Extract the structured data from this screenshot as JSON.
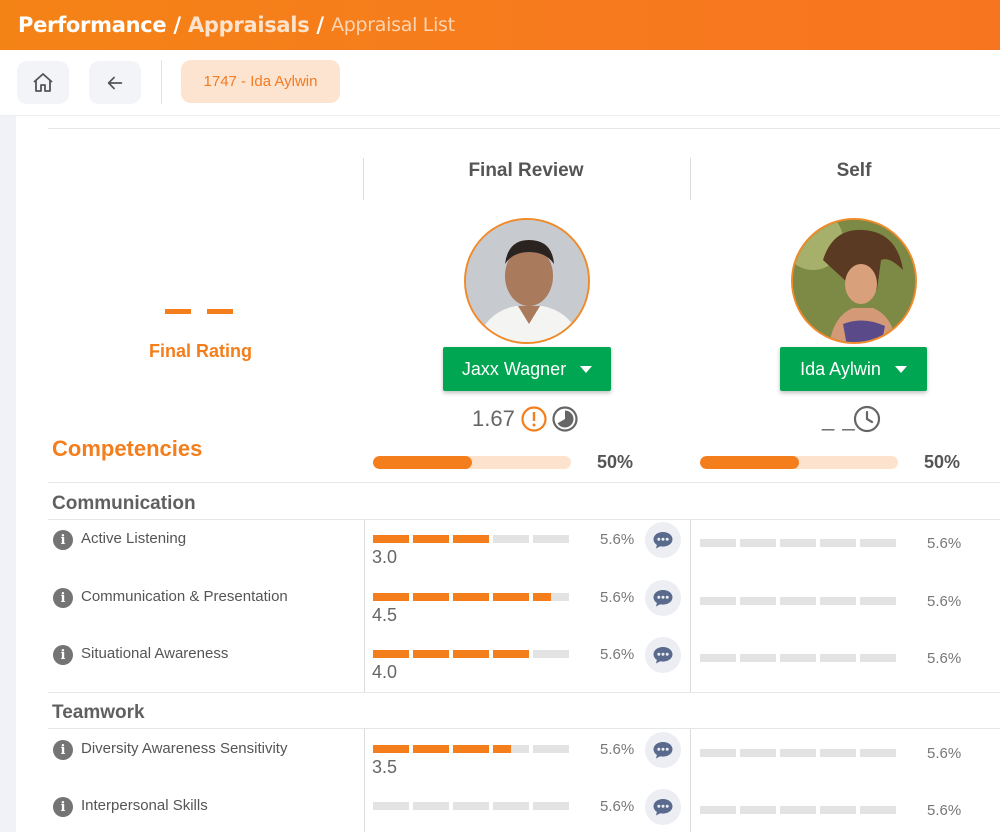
{
  "breadcrumb": {
    "root": "Performance",
    "section": "Appraisals",
    "current": "Appraisal List",
    "separator": "/"
  },
  "toolbar": {
    "home_icon": "home-icon",
    "back_icon": "arrow-left-icon",
    "employee_chip": "1747 - Ida Aylwin"
  },
  "columns": {
    "final_review": {
      "title": "Final Review",
      "reviewer": "Jaxx Wagner",
      "score": "1.67",
      "competency_progress": 0.5,
      "competency_pct": "50%"
    },
    "self": {
      "title": "Self",
      "reviewer": "Ida Aylwin",
      "score": "_ _",
      "competency_progress": 0.5,
      "competency_pct": "50%"
    }
  },
  "final_rating": {
    "label": "Final Rating",
    "value_display": "— —"
  },
  "competencies_title": "Competencies",
  "groups": [
    {
      "name": "Communication",
      "items": [
        {
          "label": "Active Listening",
          "final_rating": 3.0,
          "final_rating_text": "3.0",
          "final_weight": "5.6%",
          "self_rating": 0,
          "self_weight": "5.6%"
        },
        {
          "label": "Communication & Presentation",
          "final_rating": 4.5,
          "final_rating_text": "4.5",
          "final_weight": "5.6%",
          "self_rating": 0,
          "self_weight": "5.6%"
        },
        {
          "label": "Situational Awareness",
          "final_rating": 4.0,
          "final_rating_text": "4.0",
          "final_weight": "5.6%",
          "self_rating": 0,
          "self_weight": "5.6%"
        }
      ]
    },
    {
      "name": "Teamwork",
      "items": [
        {
          "label": "Diversity Awareness Sensitivity",
          "final_rating": 3.5,
          "final_rating_text": "3.5",
          "final_weight": "5.6%",
          "self_rating": 0,
          "self_weight": "5.6%"
        },
        {
          "label": "Interpersonal Skills",
          "final_rating": 0,
          "final_rating_text": "",
          "final_weight": "5.6%",
          "self_rating": 0,
          "self_weight": "5.6%"
        }
      ]
    }
  ],
  "colors": {
    "brand_orange": "#f47e1b",
    "success_green": "#00a651",
    "chip_bg": "#fde4d1"
  }
}
